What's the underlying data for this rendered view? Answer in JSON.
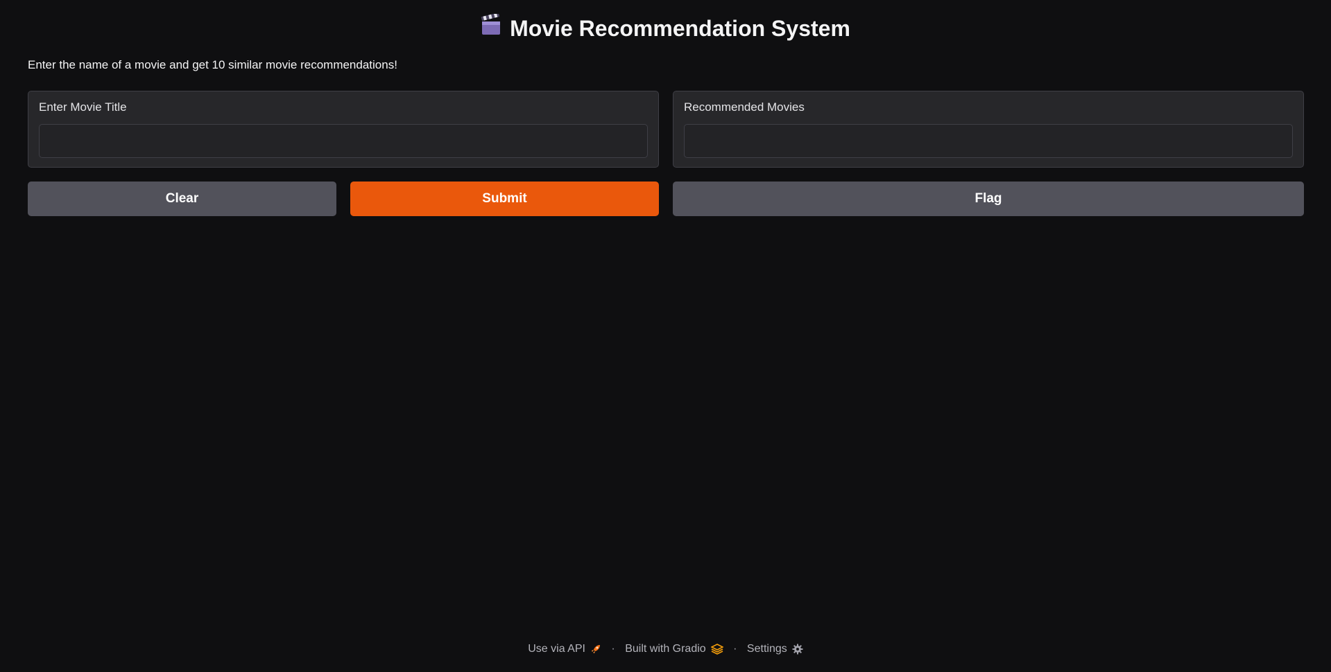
{
  "header": {
    "title": "Movie Recommendation System",
    "title_icon": "clapperboard-icon",
    "description": "Enter the name of a movie and get 10 similar movie recommendations!"
  },
  "input_panel": {
    "label": "Enter Movie Title",
    "value": "",
    "placeholder": ""
  },
  "output_panel": {
    "label": "Recommended Movies",
    "value": ""
  },
  "buttons": {
    "clear": "Clear",
    "submit": "Submit",
    "flag": "Flag"
  },
  "footer": {
    "api_label": "Use via API",
    "api_icon": "rocket-icon",
    "separator": "·",
    "built_label": "Built with Gradio",
    "built_icon": "gradio-logo-icon",
    "settings_label": "Settings",
    "settings_icon": "gear-icon"
  },
  "colors": {
    "background": "#0f0f11",
    "panel": "#27272a",
    "primary": "#ea580c",
    "secondary": "#52525b"
  }
}
